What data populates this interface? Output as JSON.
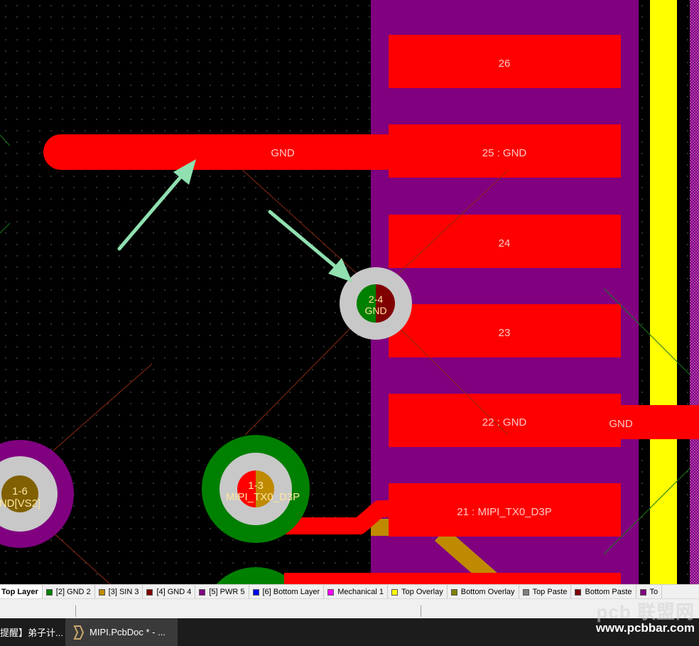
{
  "pcb": {
    "pads": [
      {
        "id": "26",
        "label": "26"
      },
      {
        "id": "25",
        "label": "25 : GND"
      },
      {
        "id": "24",
        "label": "24"
      },
      {
        "id": "23",
        "label": "23"
      },
      {
        "id": "22",
        "label": "22 : GND"
      },
      {
        "id": "21",
        "label": "21 : MIPI_TX0_D3P"
      }
    ],
    "trace_gnd_label": "GND",
    "right_gnd_label": "GND",
    "via_2_4": {
      "name": "2-4",
      "net": "GND"
    },
    "via_1_6": {
      "name": "1-6",
      "net": "ND[VS2]"
    },
    "via_1_3": {
      "name": "1-3",
      "net": "MIPI_TX0_D3P"
    },
    "colors": {
      "top_layer": "#ff0000",
      "pwr_region": "#800080",
      "top_overlay": "#ffff00",
      "via_ring": "#c8c8c8",
      "gnd2": "#008000",
      "sin3": "#c08a00",
      "arrow": "#90e0b0"
    }
  },
  "layer_tabs": [
    {
      "label": "Top Layer",
      "color": "#ff0000",
      "active": true
    },
    {
      "label": "[2] GND 2",
      "color": "#008000"
    },
    {
      "label": "[3] SIN 3",
      "color": "#c08a00"
    },
    {
      "label": "[4] GND 4",
      "color": "#800000"
    },
    {
      "label": "[5] PWR 5",
      "color": "#800080"
    },
    {
      "label": "[6] Bottom Layer",
      "color": "#0000ff"
    },
    {
      "label": "Mechanical 1",
      "color": "#ff00ff"
    },
    {
      "label": "Top Overlay",
      "color": "#ffff00"
    },
    {
      "label": "Bottom Overlay",
      "color": "#808000"
    },
    {
      "label": "Top Paste",
      "color": "#808080"
    },
    {
      "label": "Bottom Paste",
      "color": "#800000"
    },
    {
      "label": "To",
      "color": "#800080"
    }
  ],
  "taskbar": {
    "item1": "提醒】弟子计...",
    "item2": "MIPI.PcbDoc * - ..."
  },
  "watermark": {
    "logo": "pcb 联盟网",
    "url": "www.pcbbar.com"
  }
}
